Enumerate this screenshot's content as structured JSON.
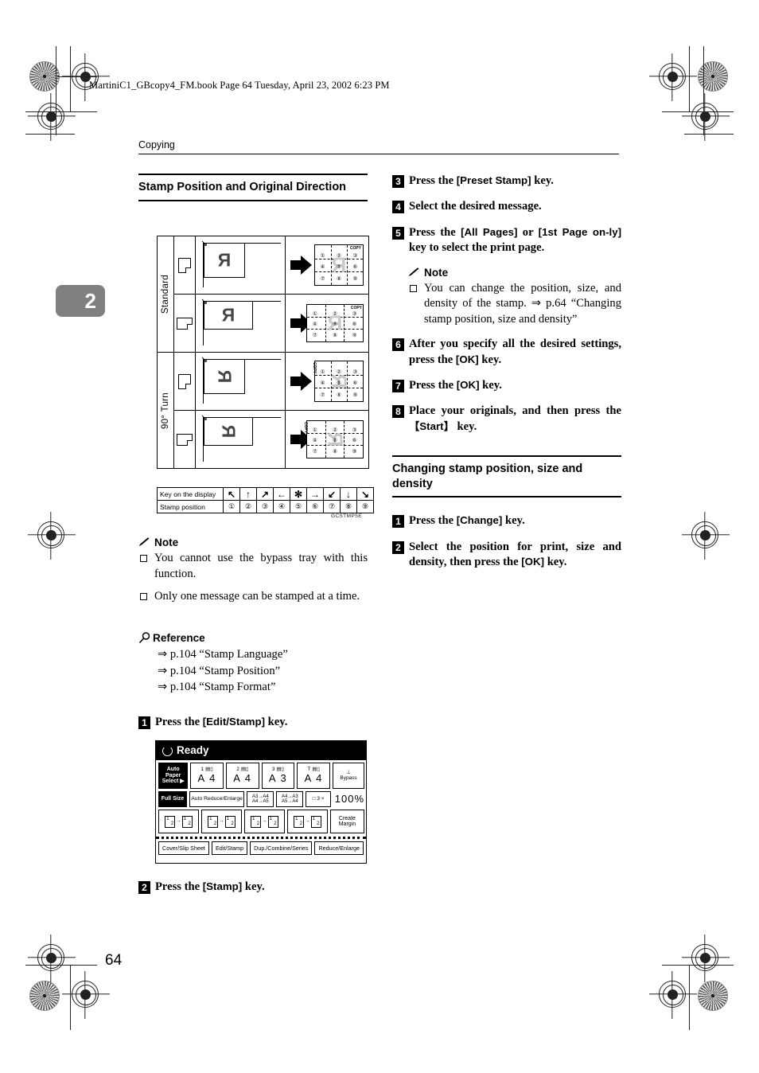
{
  "header": {
    "book_line": "MartiniC1_GBcopy4_FM.book  Page 64  Tuesday, April 23, 2002  6:23 PM",
    "running_head": "Copying",
    "chapter_tab": "2",
    "folio": "64"
  },
  "left_column": {
    "section_title": "Stamp Position and Original Direction",
    "figure": {
      "code": "GCSTMP5E",
      "row_groups": [
        {
          "label": "Standard",
          "rows": 2
        },
        {
          "label": "90° Turn",
          "rows": 2
        }
      ],
      "rows": [
        {
          "orientation": "portrait",
          "original_glyph": "R",
          "result_glyph": "R",
          "copy_tag": "COPY",
          "copy_tag_pos": "top-right"
        },
        {
          "orientation": "landscape",
          "original_glyph": "R",
          "result_glyph": "R",
          "copy_tag": "COPY",
          "copy_tag_pos": "top-right"
        },
        {
          "orientation": "portrait",
          "original_glyph": "R",
          "result_glyph": "R",
          "copy_tag": "COPY",
          "copy_tag_pos": "top-left"
        },
        {
          "orientation": "landscape",
          "original_glyph": "R",
          "result_glyph": "R",
          "copy_tag": "COPY",
          "copy_tag_pos": "top-left"
        }
      ],
      "grid_numbers": [
        "①",
        "②",
        "③",
        "④",
        "⑤",
        "⑥",
        "⑦",
        "⑧",
        "⑨"
      ],
      "legend": {
        "row1_label": "Key on the display",
        "row2_label": "Stamp position",
        "keys": [
          "↖",
          "↑",
          "↗",
          "←",
          "✻",
          "→",
          "↙",
          "↓",
          "↘"
        ],
        "positions": [
          "①",
          "②",
          "③",
          "④",
          "⑤",
          "⑥",
          "⑦",
          "⑧",
          "⑨"
        ]
      }
    },
    "note_title": "Note",
    "notes": [
      "You cannot use the bypass tray with this function.",
      "Only one message can be stamped at a time."
    ],
    "reference_title": "Reference",
    "references": [
      "⇒ p.104 “Stamp Language”",
      "⇒ p.104 “Stamp Position”",
      "⇒ p.104 “Stamp Format”"
    ],
    "steps": [
      {
        "num": "1",
        "parts": [
          {
            "t": "Press the "
          },
          {
            "t": "[Edit/Stamp]",
            "ui": true
          },
          {
            "t": " key."
          }
        ]
      },
      {
        "num": "2",
        "parts": [
          {
            "t": "Press the "
          },
          {
            "t": "[Stamp]",
            "ui": true
          },
          {
            "t": " key."
          }
        ]
      }
    ],
    "lcd": {
      "status": "Ready",
      "paper_select_label_1": "Auto Paper",
      "paper_select_label_2": "Select ▶",
      "trays": [
        {
          "num": "1",
          "size": "A 4"
        },
        {
          "num": "2",
          "size": "A 4"
        },
        {
          "num": "3",
          "size": "A 3"
        },
        {
          "num": "T",
          "size": "A 4"
        }
      ],
      "bypass": "Bypass",
      "full_size": "Full Size",
      "auto_reduce_enlarge": "Auto Reduce/Enlarge",
      "ratio1_line1": "A3→A4",
      "ratio1_line2": "A4→A5",
      "ratio2_line1": "A4→A3",
      "ratio2_line2": "A5→A4",
      "zoom_key": "□ 3 ×",
      "percent": "100%",
      "create_margin_line1": "Create",
      "create_margin_line2": "Margin",
      "tabs": [
        "Cover/Slip Sheet",
        "Edit/Stamp",
        "Dup./Combine/Series",
        "Reduce/Enlarge"
      ]
    }
  },
  "right_column": {
    "steps": [
      {
        "num": "3",
        "parts": [
          {
            "t": "Press the "
          },
          {
            "t": "[Preset Stamp]",
            "ui": true
          },
          {
            "t": " key."
          }
        ]
      },
      {
        "num": "4",
        "parts": [
          {
            "t": "Select the desired message."
          }
        ]
      },
      {
        "num": "5",
        "parts": [
          {
            "t": "Press the "
          },
          {
            "t": "[All Pages]",
            "ui": true
          },
          {
            "t": " or "
          },
          {
            "t": "[1st Page on-ly]",
            "ui": true
          },
          {
            "t": " key to select the print page."
          }
        ]
      }
    ],
    "note_title": "Note",
    "notes": [
      "You can change the position, size, and density of the stamp. ⇒ p.64 “Changing stamp position, size and density”"
    ],
    "steps2": [
      {
        "num": "6",
        "parts": [
          {
            "t": "After you specify all the desired settings, press the "
          },
          {
            "t": "[OK]",
            "ui": true
          },
          {
            "t": " key."
          }
        ]
      },
      {
        "num": "7",
        "parts": [
          {
            "t": "Press the "
          },
          {
            "t": "[OK]",
            "ui": true
          },
          {
            "t": " key."
          }
        ]
      },
      {
        "num": "8",
        "parts": [
          {
            "t": "Place your originals, and then press the "
          },
          {
            "t": "【Start】",
            "ui": true
          },
          {
            "t": " key."
          }
        ]
      }
    ],
    "section_title": "Changing stamp position, size and density",
    "steps3": [
      {
        "num": "1",
        "parts": [
          {
            "t": "Press the "
          },
          {
            "t": "[Change]",
            "ui": true
          },
          {
            "t": " key."
          }
        ]
      },
      {
        "num": "2",
        "parts": [
          {
            "t": "Select the position for print, size and density, then press the "
          },
          {
            "t": "[OK]",
            "ui": true
          },
          {
            "t": " key."
          }
        ]
      }
    ]
  }
}
